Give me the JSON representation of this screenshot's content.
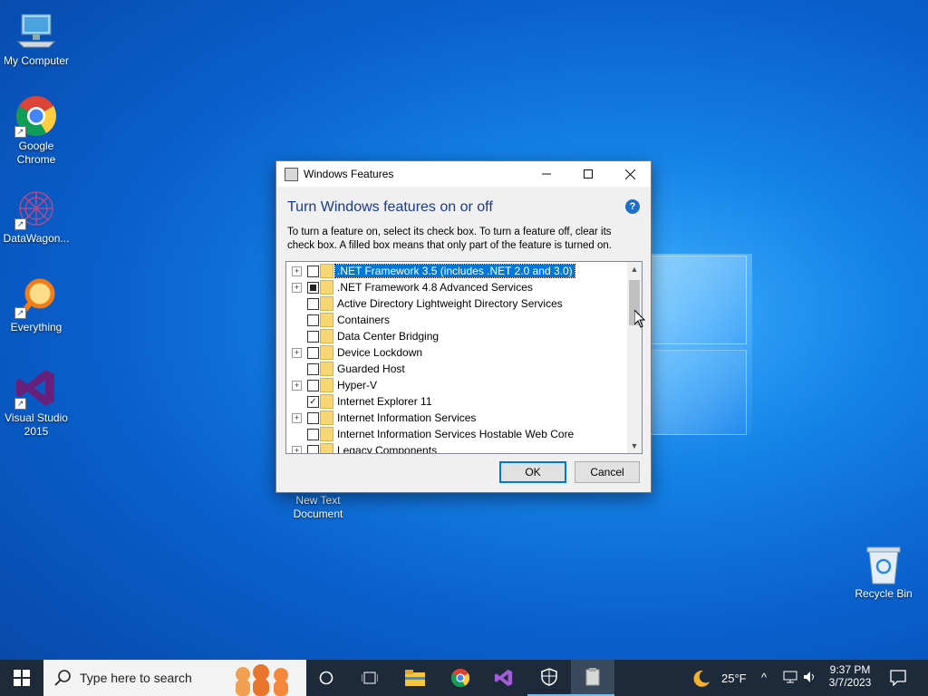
{
  "desktop": {
    "icons": [
      {
        "name": "My Computer"
      },
      {
        "name": "Google Chrome"
      },
      {
        "name": "DataWagon..."
      },
      {
        "name": "Everything"
      },
      {
        "name": "Visual Studio 2015"
      },
      {
        "name": "New Text Document"
      },
      {
        "name": "Recycle Bin"
      }
    ]
  },
  "window": {
    "title": "Windows Features",
    "heading": "Turn Windows features on or off",
    "help": "?",
    "description": "To turn a feature on, select its check box. To turn a feature off, clear its check box. A filled box means that only part of the feature is turned on.",
    "features": [
      {
        "label": ".NET Framework 3.5 (includes .NET 2.0 and 3.0)",
        "state": "unchecked",
        "expandable": true,
        "selected": true
      },
      {
        "label": ".NET Framework 4.8 Advanced Services",
        "state": "partial",
        "expandable": true
      },
      {
        "label": "Active Directory Lightweight Directory Services",
        "state": "unchecked",
        "expandable": false
      },
      {
        "label": "Containers",
        "state": "unchecked",
        "expandable": false
      },
      {
        "label": "Data Center Bridging",
        "state": "unchecked",
        "expandable": false
      },
      {
        "label": "Device Lockdown",
        "state": "unchecked",
        "expandable": true
      },
      {
        "label": "Guarded Host",
        "state": "unchecked",
        "expandable": false
      },
      {
        "label": "Hyper-V",
        "state": "unchecked",
        "expandable": true
      },
      {
        "label": "Internet Explorer 11",
        "state": "checked",
        "expandable": false
      },
      {
        "label": "Internet Information Services",
        "state": "unchecked",
        "expandable": true
      },
      {
        "label": "Internet Information Services Hostable Web Core",
        "state": "unchecked",
        "expandable": false
      },
      {
        "label": "Legacy Components",
        "state": "unchecked",
        "expandable": true
      }
    ],
    "ok_label": "OK",
    "cancel_label": "Cancel"
  },
  "taskbar": {
    "search_placeholder": "Type here to search",
    "weather": "25°F",
    "time": "9:37 PM",
    "date": "3/7/2023"
  }
}
